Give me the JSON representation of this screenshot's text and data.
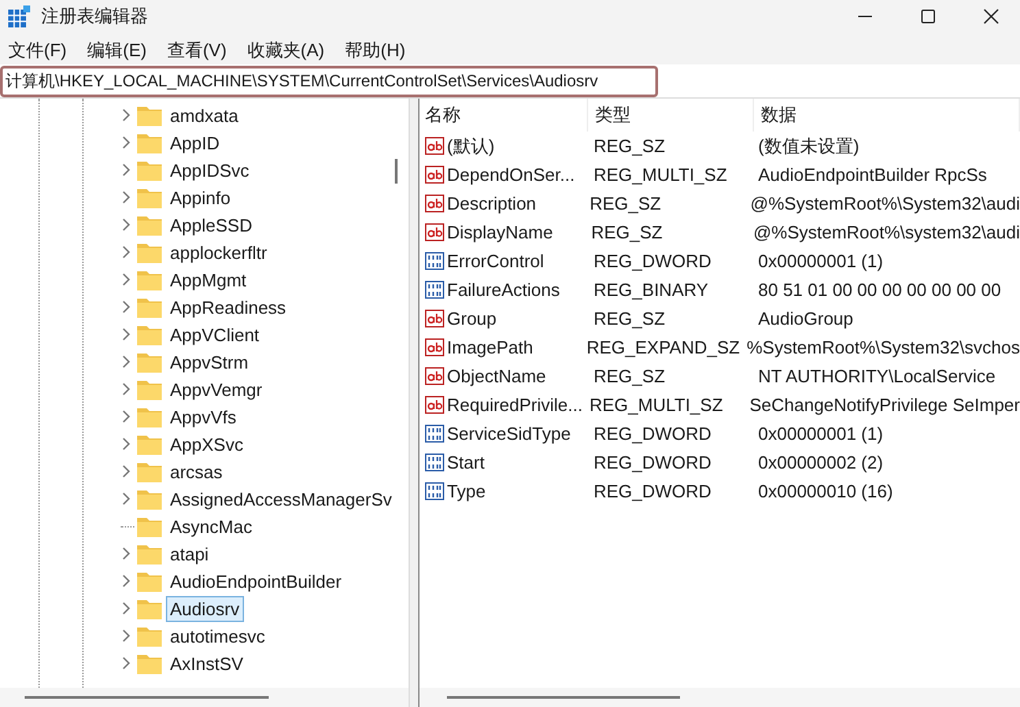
{
  "window": {
    "title": "注册表编辑器"
  },
  "menu": [
    "文件(F)",
    "编辑(E)",
    "查看(V)",
    "收藏夹(A)",
    "帮助(H)"
  ],
  "address": {
    "value": "计算机\\HKEY_LOCAL_MACHINE\\SYSTEM\\CurrentControlSet\\Services\\Audiosrv"
  },
  "tree": {
    "items": [
      {
        "label": "amdxata",
        "expandable": true,
        "selected": false
      },
      {
        "label": "AppID",
        "expandable": true,
        "selected": false
      },
      {
        "label": "AppIDSvc",
        "expandable": true,
        "selected": false
      },
      {
        "label": "Appinfo",
        "expandable": true,
        "selected": false
      },
      {
        "label": "AppleSSD",
        "expandable": true,
        "selected": false
      },
      {
        "label": "applockerfltr",
        "expandable": true,
        "selected": false
      },
      {
        "label": "AppMgmt",
        "expandable": true,
        "selected": false
      },
      {
        "label": "AppReadiness",
        "expandable": true,
        "selected": false
      },
      {
        "label": "AppVClient",
        "expandable": true,
        "selected": false
      },
      {
        "label": "AppvStrm",
        "expandable": true,
        "selected": false
      },
      {
        "label": "AppvVemgr",
        "expandable": true,
        "selected": false
      },
      {
        "label": "AppvVfs",
        "expandable": true,
        "selected": false
      },
      {
        "label": "AppXSvc",
        "expandable": true,
        "selected": false
      },
      {
        "label": "arcsas",
        "expandable": true,
        "selected": false
      },
      {
        "label": "AssignedAccessManagerSv",
        "expandable": true,
        "selected": false
      },
      {
        "label": "AsyncMac",
        "expandable": false,
        "selected": false
      },
      {
        "label": "atapi",
        "expandable": true,
        "selected": false
      },
      {
        "label": "AudioEndpointBuilder",
        "expandable": true,
        "selected": false
      },
      {
        "label": "Audiosrv",
        "expandable": true,
        "selected": true
      },
      {
        "label": "autotimesvc",
        "expandable": true,
        "selected": false
      },
      {
        "label": "AxInstSV",
        "expandable": true,
        "selected": false
      }
    ]
  },
  "values": {
    "columns": [
      "名称",
      "类型",
      "数据"
    ],
    "rows": [
      {
        "kind": "string",
        "name": "(默认)",
        "type": "REG_SZ",
        "data": "(数值未设置)"
      },
      {
        "kind": "string",
        "name": "DependOnSer...",
        "type": "REG_MULTI_SZ",
        "data": "AudioEndpointBuilder RpcSs"
      },
      {
        "kind": "string",
        "name": "Description",
        "type": "REG_SZ",
        "data": "@%SystemRoot%\\System32\\audi"
      },
      {
        "kind": "string",
        "name": "DisplayName",
        "type": "REG_SZ",
        "data": "@%SystemRoot%\\system32\\audi"
      },
      {
        "kind": "binary",
        "name": "ErrorControl",
        "type": "REG_DWORD",
        "data": "0x00000001 (1)"
      },
      {
        "kind": "binary",
        "name": "FailureActions",
        "type": "REG_BINARY",
        "data": "80 51 01 00 00 00 00 00 00 00"
      },
      {
        "kind": "string",
        "name": "Group",
        "type": "REG_SZ",
        "data": "AudioGroup"
      },
      {
        "kind": "string",
        "name": "ImagePath",
        "type": "REG_EXPAND_SZ",
        "data": "%SystemRoot%\\System32\\svchos"
      },
      {
        "kind": "string",
        "name": "ObjectName",
        "type": "REG_SZ",
        "data": "NT AUTHORITY\\LocalService"
      },
      {
        "kind": "string",
        "name": "RequiredPrivile...",
        "type": "REG_MULTI_SZ",
        "data": "SeChangeNotifyPrivilege SeImper"
      },
      {
        "kind": "binary",
        "name": "ServiceSidType",
        "type": "REG_DWORD",
        "data": "0x00000001 (1)"
      },
      {
        "kind": "binary",
        "name": "Start",
        "type": "REG_DWORD",
        "data": "0x00000002 (2)"
      },
      {
        "kind": "binary",
        "name": "Type",
        "type": "REG_DWORD",
        "data": "0x00000010 (16)"
      }
    ]
  }
}
